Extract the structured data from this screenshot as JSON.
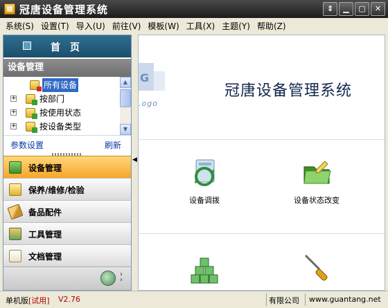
{
  "window": {
    "title": "冠唐设备管理系统",
    "controls": {
      "menu": "⇕",
      "minimize": "▁",
      "maximize": "▢",
      "close": "✕"
    }
  },
  "menubar": {
    "items": [
      "系统(S)",
      "设置(T)",
      "导入(U)",
      "前往(V)",
      "模板(W)",
      "工具(X)",
      "主题(Y)",
      "帮助(Z)"
    ]
  },
  "sidebar": {
    "home_label": "首页",
    "section_title": "设备管理",
    "tree": [
      {
        "label": "所有设备",
        "selected": true,
        "icon": "folder-doc-icon"
      },
      {
        "label": "按部门",
        "selected": false,
        "icon": "folder-add-icon"
      },
      {
        "label": "按使用状态",
        "selected": false,
        "icon": "folder-add-icon"
      },
      {
        "label": "按设备类型",
        "selected": false,
        "icon": "folder-add-icon"
      }
    ],
    "links": {
      "params": "参数设置",
      "refresh": "刷新"
    },
    "nav": [
      {
        "label": "设备管理",
        "active": true,
        "icon": "folder-open-icon"
      },
      {
        "label": "保养/维修/检验",
        "active": false,
        "icon": "maintenance-icon"
      },
      {
        "label": "备品配件",
        "active": false,
        "icon": "ruler-icon"
      },
      {
        "label": "工具管理",
        "active": false,
        "icon": "tools-icon"
      },
      {
        "label": "文档管理",
        "active": false,
        "icon": "clipboard-icon"
      }
    ]
  },
  "main": {
    "banner": {
      "title": "冠唐设备管理系统",
      "logo_text": "G",
      "logo_sub": ".ogo"
    },
    "tiles": [
      {
        "label": "设备调拨",
        "icon": "transfer-icon"
      },
      {
        "label": "设备状态改变",
        "icon": "status-change-icon"
      },
      {
        "label": "",
        "icon": "cubes-icon"
      },
      {
        "label": "",
        "icon": "screwdriver-icon"
      }
    ]
  },
  "statusbar": {
    "edition": "单机版",
    "trial": "[试用]",
    "version": "V2.76",
    "company": "有限公司",
    "url": "www.guantang.net"
  },
  "colors": {
    "accent_orange": "#f7a62a",
    "banner_text": "#13264d",
    "selected_blue": "#316ac5",
    "link_blue": "#0b37a6"
  }
}
